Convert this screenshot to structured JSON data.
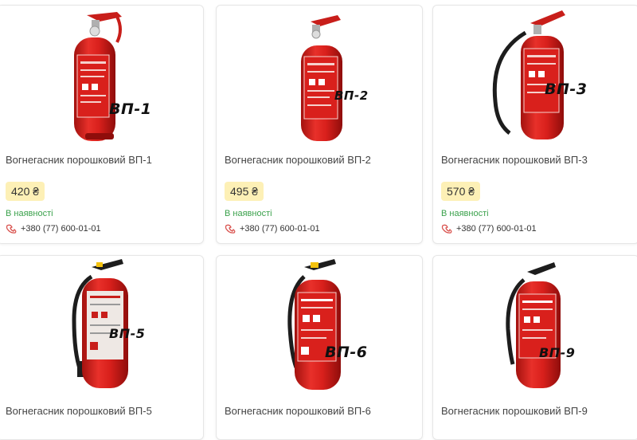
{
  "products": [
    {
      "model": "ВП-1",
      "title": "Вогнегасник порошковий ВП-1",
      "price": "420 ₴",
      "stock": "В наявності",
      "phone": "+380 (77) 600-01-01"
    },
    {
      "model": "ВП-2",
      "title": "Вогнегасник порошковий ВП-2",
      "price": "495 ₴",
      "stock": "В наявності",
      "phone": "+380 (77) 600-01-01"
    },
    {
      "model": "ВП-3",
      "title": "Вогнегасник порошковий ВП-3",
      "price": "570 ₴",
      "stock": "В наявності",
      "phone": "+380 (77) 600-01-01"
    },
    {
      "model": "ВП-5",
      "title": "Вогнегасник порошковий ВП-5"
    },
    {
      "model": "ВП-6",
      "title": "Вогнегасник порошковий ВП-6"
    },
    {
      "model": "ВП-9",
      "title": "Вогнегасник порошковий ВП-9"
    }
  ],
  "colors": {
    "price_bg": "#fdf0b6",
    "stock_green": "#3aa14b",
    "extinguisher_red": "#d9201c",
    "phone_icon": "#d9534f"
  },
  "icons": {
    "phone": "phone-icon"
  }
}
